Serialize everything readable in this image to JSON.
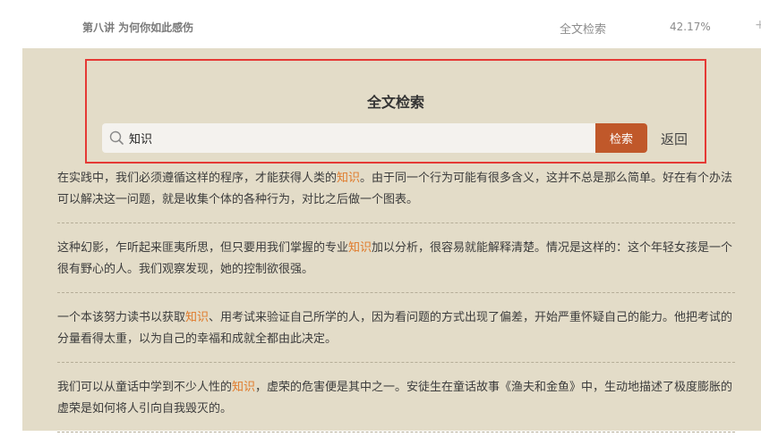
{
  "header": {
    "chapter_title": "第八讲 为何你如此感伤",
    "search_link": "全文检索",
    "progress": "42.17%",
    "edge_symbol": "+"
  },
  "search_panel": {
    "title": "全文检索",
    "input_value": "知识",
    "search_button": "检索",
    "back_link": "返回"
  },
  "results": [
    {
      "before": "在实践中，我们必须遵循这样的程序，才能获得人类的",
      "highlight": "知识",
      "after": "。由于同一个行为可能有很多含义，这并不总是那么简单。好在有个办法可以解决这一问题，就是收集个体的各种行为，对比之后做一个图表。"
    },
    {
      "before": "这种幻影，乍听起来匪夷所思，但只要用我们掌握的专业",
      "highlight": "知识",
      "after": "加以分析，很容易就能解释清楚。情况是这样的：这个年轻女孩是一个很有野心的人。我们观察发现，她的控制欲很强。"
    },
    {
      "before": "一个本该努力读书以获取",
      "highlight": "知识",
      "after": "、用考试来验证自己所学的人，因为看问题的方式出现了偏差，开始严重怀疑自己的能力。他把考试的分量看得太重，以为自己的幸福和成就全都由此决定。"
    },
    {
      "before": "我们可以从童话中学到不少人性的",
      "highlight": "知识",
      "after": "，虚荣的危害便是其中之一。安徒生在童话故事《渔夫和金鱼》中，生动地描述了极度膨胀的虚荣是如何将人引向自我毁灭的。"
    }
  ],
  "colors": {
    "background": "#e3dcc8",
    "accent_button": "#c0582a",
    "highlight": "#e07a2a",
    "panel_border": "#e53935"
  },
  "icons": {
    "search": "search-icon"
  }
}
